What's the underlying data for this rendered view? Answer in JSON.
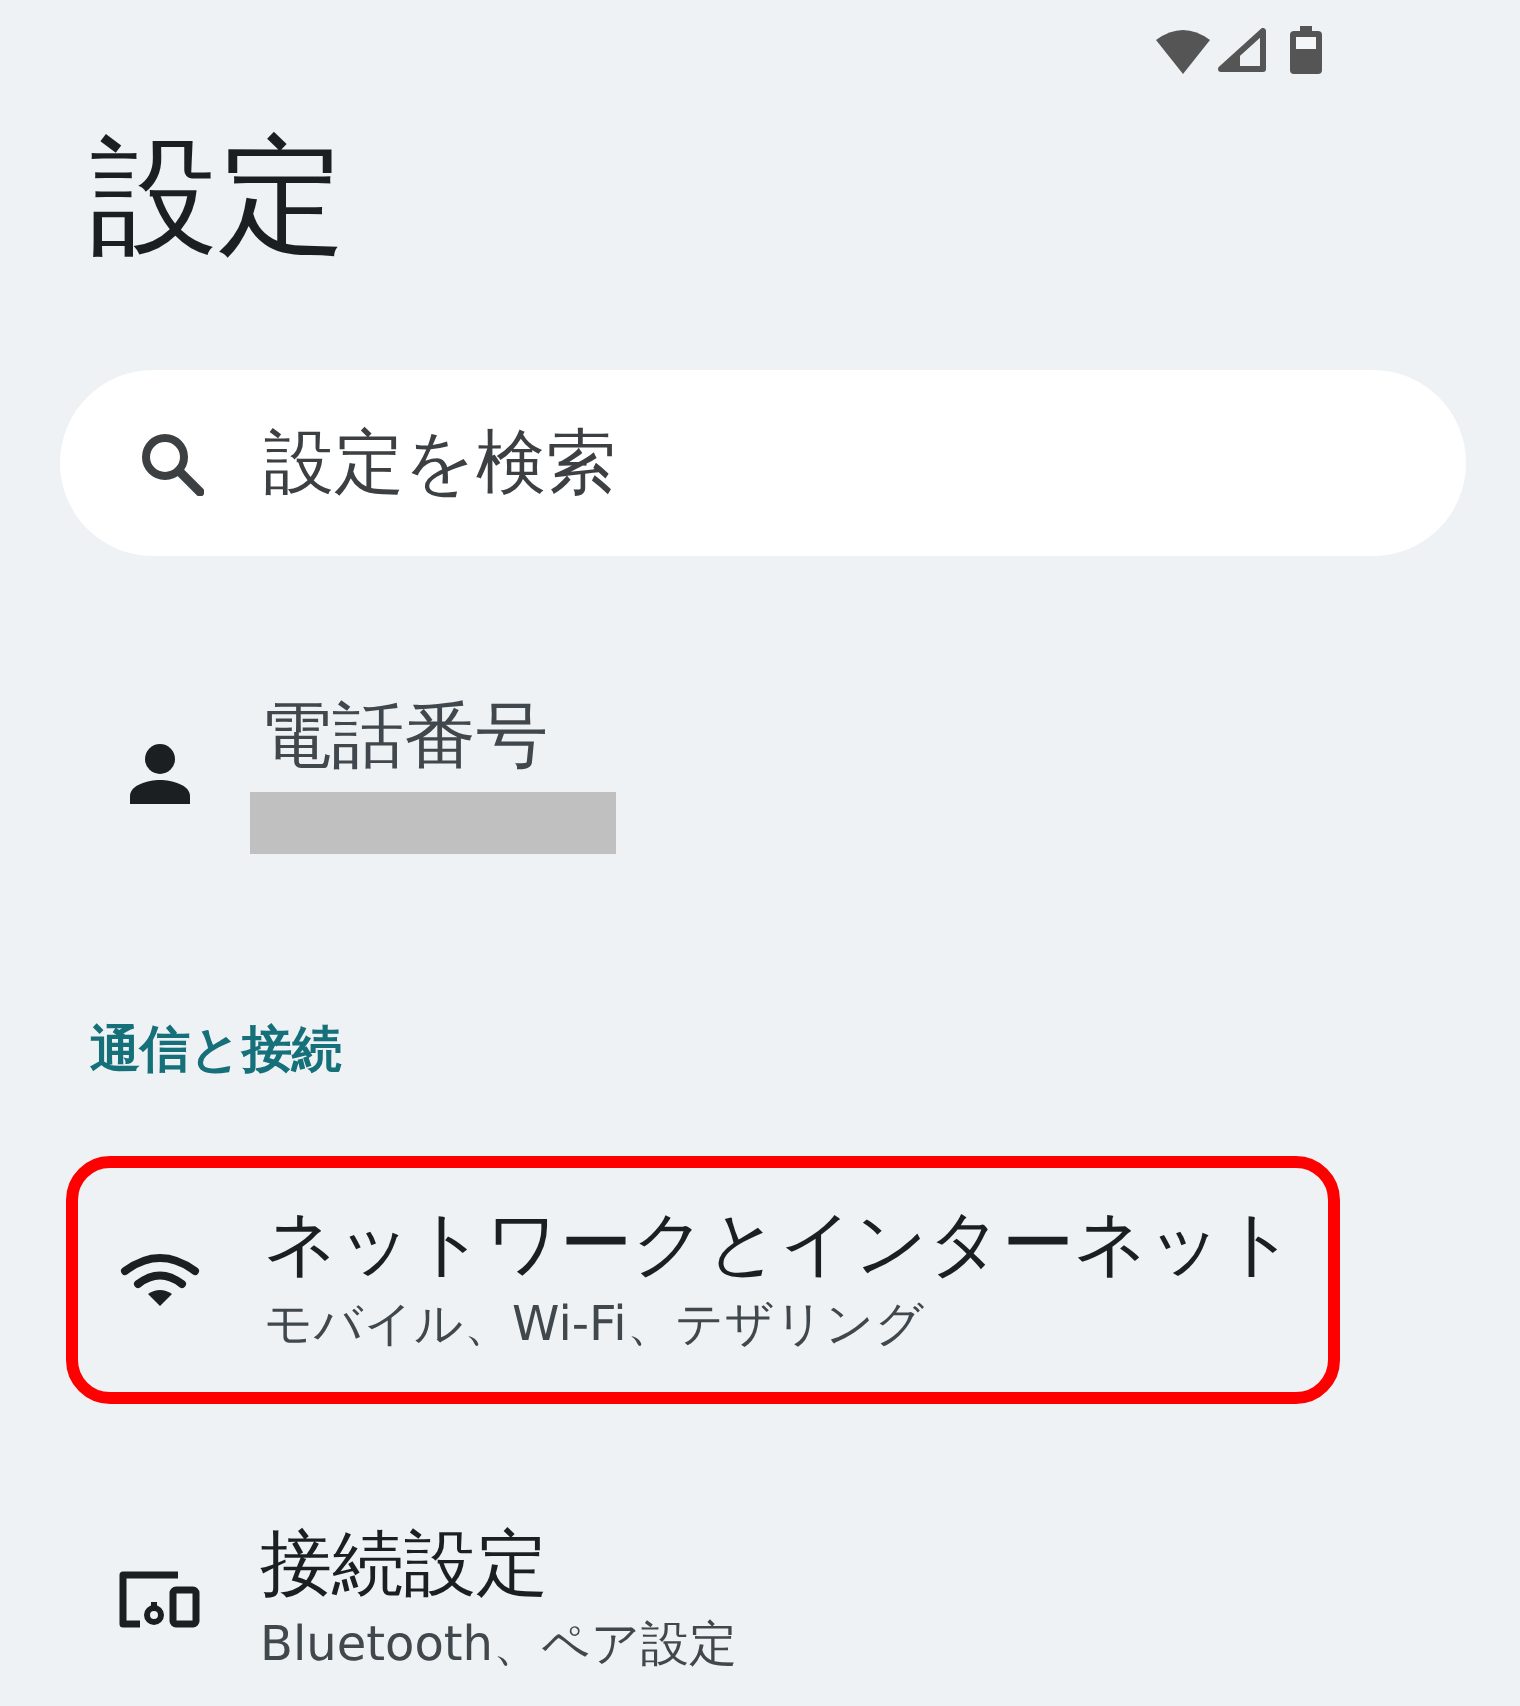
{
  "title": "設定",
  "search": {
    "placeholder": "設定を検索"
  },
  "account": {
    "title": "電話番号",
    "redacted": true
  },
  "sections": [
    {
      "header": "通信と接続",
      "items": [
        {
          "kind": "network",
          "title": "ネットワークとインターネット",
          "subtitle": "モバイル、Wi-Fi、テザリング",
          "highlighted": true
        },
        {
          "kind": "devices",
          "title": "接続設定",
          "subtitle": "Bluetooth、ペア設定",
          "highlighted": false
        }
      ]
    }
  ]
}
